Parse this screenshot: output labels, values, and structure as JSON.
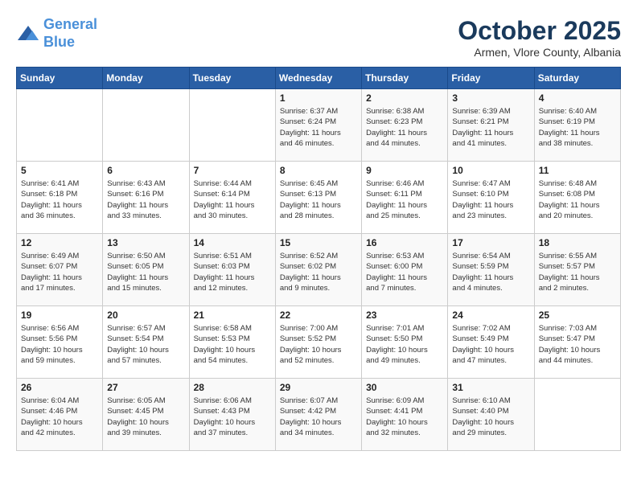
{
  "header": {
    "logo_line1": "General",
    "logo_line2": "Blue",
    "month": "October 2025",
    "location": "Armen, Vlore County, Albania"
  },
  "days_of_week": [
    "Sunday",
    "Monday",
    "Tuesday",
    "Wednesday",
    "Thursday",
    "Friday",
    "Saturday"
  ],
  "weeks": [
    [
      {
        "day": "",
        "info": ""
      },
      {
        "day": "",
        "info": ""
      },
      {
        "day": "",
        "info": ""
      },
      {
        "day": "1",
        "info": "Sunrise: 6:37 AM\nSunset: 6:24 PM\nDaylight: 11 hours\nand 46 minutes."
      },
      {
        "day": "2",
        "info": "Sunrise: 6:38 AM\nSunset: 6:23 PM\nDaylight: 11 hours\nand 44 minutes."
      },
      {
        "day": "3",
        "info": "Sunrise: 6:39 AM\nSunset: 6:21 PM\nDaylight: 11 hours\nand 41 minutes."
      },
      {
        "day": "4",
        "info": "Sunrise: 6:40 AM\nSunset: 6:19 PM\nDaylight: 11 hours\nand 38 minutes."
      }
    ],
    [
      {
        "day": "5",
        "info": "Sunrise: 6:41 AM\nSunset: 6:18 PM\nDaylight: 11 hours\nand 36 minutes."
      },
      {
        "day": "6",
        "info": "Sunrise: 6:43 AM\nSunset: 6:16 PM\nDaylight: 11 hours\nand 33 minutes."
      },
      {
        "day": "7",
        "info": "Sunrise: 6:44 AM\nSunset: 6:14 PM\nDaylight: 11 hours\nand 30 minutes."
      },
      {
        "day": "8",
        "info": "Sunrise: 6:45 AM\nSunset: 6:13 PM\nDaylight: 11 hours\nand 28 minutes."
      },
      {
        "day": "9",
        "info": "Sunrise: 6:46 AM\nSunset: 6:11 PM\nDaylight: 11 hours\nand 25 minutes."
      },
      {
        "day": "10",
        "info": "Sunrise: 6:47 AM\nSunset: 6:10 PM\nDaylight: 11 hours\nand 23 minutes."
      },
      {
        "day": "11",
        "info": "Sunrise: 6:48 AM\nSunset: 6:08 PM\nDaylight: 11 hours\nand 20 minutes."
      }
    ],
    [
      {
        "day": "12",
        "info": "Sunrise: 6:49 AM\nSunset: 6:07 PM\nDaylight: 11 hours\nand 17 minutes."
      },
      {
        "day": "13",
        "info": "Sunrise: 6:50 AM\nSunset: 6:05 PM\nDaylight: 11 hours\nand 15 minutes."
      },
      {
        "day": "14",
        "info": "Sunrise: 6:51 AM\nSunset: 6:03 PM\nDaylight: 11 hours\nand 12 minutes."
      },
      {
        "day": "15",
        "info": "Sunrise: 6:52 AM\nSunset: 6:02 PM\nDaylight: 11 hours\nand 9 minutes."
      },
      {
        "day": "16",
        "info": "Sunrise: 6:53 AM\nSunset: 6:00 PM\nDaylight: 11 hours\nand 7 minutes."
      },
      {
        "day": "17",
        "info": "Sunrise: 6:54 AM\nSunset: 5:59 PM\nDaylight: 11 hours\nand 4 minutes."
      },
      {
        "day": "18",
        "info": "Sunrise: 6:55 AM\nSunset: 5:57 PM\nDaylight: 11 hours\nand 2 minutes."
      }
    ],
    [
      {
        "day": "19",
        "info": "Sunrise: 6:56 AM\nSunset: 5:56 PM\nDaylight: 10 hours\nand 59 minutes."
      },
      {
        "day": "20",
        "info": "Sunrise: 6:57 AM\nSunset: 5:54 PM\nDaylight: 10 hours\nand 57 minutes."
      },
      {
        "day": "21",
        "info": "Sunrise: 6:58 AM\nSunset: 5:53 PM\nDaylight: 10 hours\nand 54 minutes."
      },
      {
        "day": "22",
        "info": "Sunrise: 7:00 AM\nSunset: 5:52 PM\nDaylight: 10 hours\nand 52 minutes."
      },
      {
        "day": "23",
        "info": "Sunrise: 7:01 AM\nSunset: 5:50 PM\nDaylight: 10 hours\nand 49 minutes."
      },
      {
        "day": "24",
        "info": "Sunrise: 7:02 AM\nSunset: 5:49 PM\nDaylight: 10 hours\nand 47 minutes."
      },
      {
        "day": "25",
        "info": "Sunrise: 7:03 AM\nSunset: 5:47 PM\nDaylight: 10 hours\nand 44 minutes."
      }
    ],
    [
      {
        "day": "26",
        "info": "Sunrise: 6:04 AM\nSunset: 4:46 PM\nDaylight: 10 hours\nand 42 minutes."
      },
      {
        "day": "27",
        "info": "Sunrise: 6:05 AM\nSunset: 4:45 PM\nDaylight: 10 hours\nand 39 minutes."
      },
      {
        "day": "28",
        "info": "Sunrise: 6:06 AM\nSunset: 4:43 PM\nDaylight: 10 hours\nand 37 minutes."
      },
      {
        "day": "29",
        "info": "Sunrise: 6:07 AM\nSunset: 4:42 PM\nDaylight: 10 hours\nand 34 minutes."
      },
      {
        "day": "30",
        "info": "Sunrise: 6:09 AM\nSunset: 4:41 PM\nDaylight: 10 hours\nand 32 minutes."
      },
      {
        "day": "31",
        "info": "Sunrise: 6:10 AM\nSunset: 4:40 PM\nDaylight: 10 hours\nand 29 minutes."
      },
      {
        "day": "",
        "info": ""
      }
    ]
  ]
}
